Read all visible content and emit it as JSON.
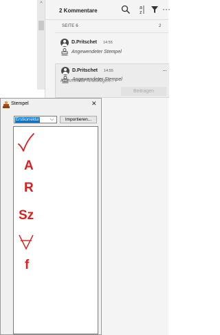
{
  "comments_panel": {
    "header_count": "2 Kommentare",
    "page_label": "SEITE 6",
    "page_count": "2",
    "more_glyph": "···",
    "comments": [
      {
        "author": "D.Pritschet",
        "time": "14:55",
        "description": "Angewendeter Stempel"
      },
      {
        "author": "D.Pritschet",
        "time": "14:55",
        "description": "Angewendeter Stempel"
      }
    ],
    "reply_placeholder": "Kommentar hinzufügen...",
    "post_button": "Beitragen"
  },
  "stamp_dialog": {
    "title": "Stempel",
    "close_glyph": "✕",
    "category": "Erstkorrektur",
    "import_button": "Importieren...",
    "stamps": [
      "✓",
      "A",
      "R",
      "Sz",
      "∀",
      "f"
    ]
  },
  "colors": {
    "stamp_red": "#e21d1d",
    "selection_blue": "#0078d7",
    "panel_bg": "#f4f4f4"
  }
}
